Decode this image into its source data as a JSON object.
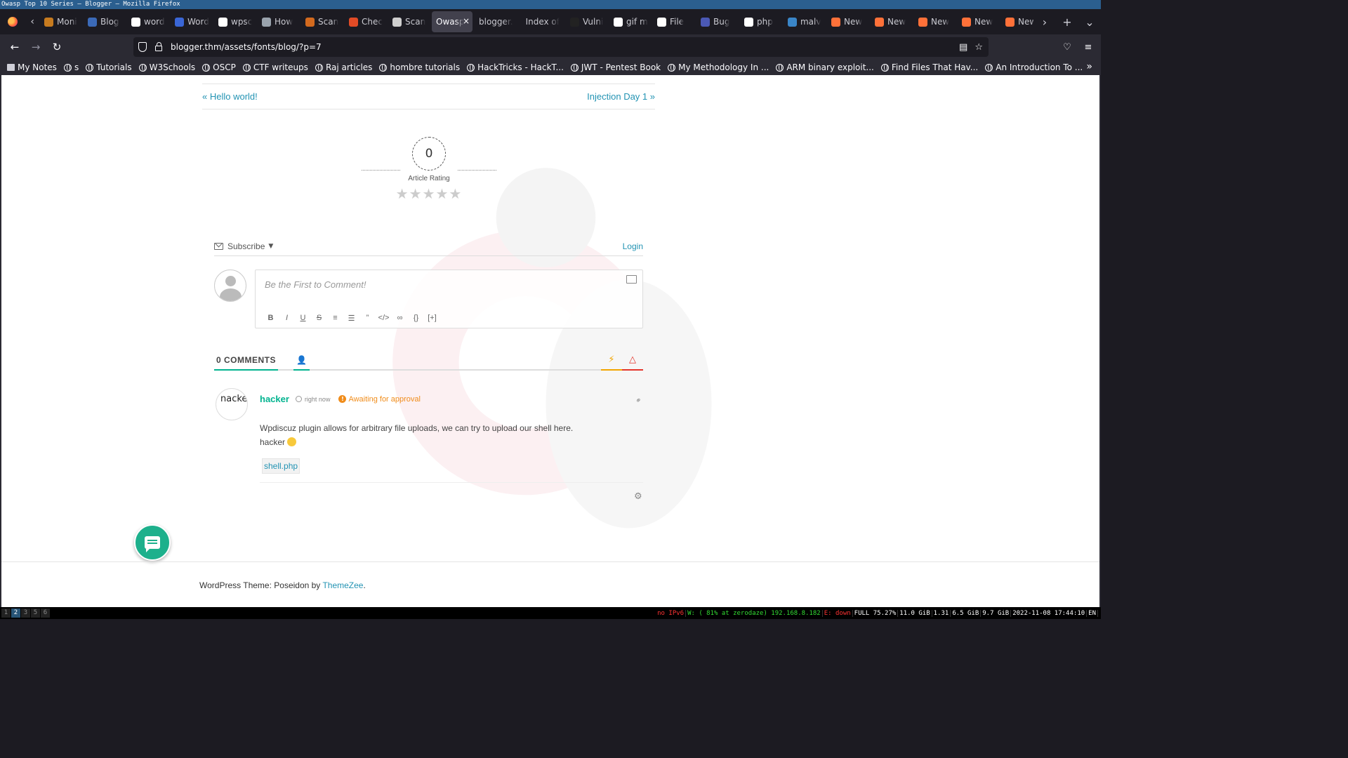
{
  "window": {
    "title": "Owasp Top 10 Series — Blogger — Mozilla Firefox"
  },
  "tabs": [
    {
      "label": "Moni",
      "color": "#c77b1f"
    },
    {
      "label": "Blog",
      "color": "#3b6ab8"
    },
    {
      "label": "word",
      "color": "#ffffff"
    },
    {
      "label": "Word",
      "color": "#3a66d6"
    },
    {
      "label": "wpsc",
      "color": "#ffffff"
    },
    {
      "label": "How",
      "color": "#9aa3ad"
    },
    {
      "label": "Scan",
      "color": "#d36a1e"
    },
    {
      "label": "Chec",
      "color": "#e24b26"
    },
    {
      "label": "Scan",
      "color": "#cfcfcf"
    },
    {
      "label": "Owasp",
      "active": true
    },
    {
      "label": "blogger."
    },
    {
      "label": "Index of"
    },
    {
      "label": "Vulni",
      "color": "#222222"
    },
    {
      "label": "gif m",
      "color": "#ffffff"
    },
    {
      "label": "File",
      "color": "#ffffff"
    },
    {
      "label": "Bug",
      "color": "#4b59b5"
    },
    {
      "label": "php",
      "color": "#ffffff"
    },
    {
      "label": "malv",
      "color": "#3a86c8"
    },
    {
      "label": "New",
      "color": "#ff7139"
    },
    {
      "label": "New",
      "color": "#ff7139"
    },
    {
      "label": "New",
      "color": "#ff7139"
    },
    {
      "label": "New",
      "color": "#ff7139"
    },
    {
      "label": "New",
      "color": "#ff7139"
    }
  ],
  "nav": {
    "url": "blogger.thm/assets/fonts/blog/?p=7"
  },
  "bookmarks": [
    "My Notes",
    "s",
    "Tutorials",
    "W3Schools",
    "OSCP",
    "CTF writeups",
    "Raj articles",
    "hombre tutorials",
    "HackTricks - HackT...",
    "JWT - Pentest Book",
    "My Methodology In ...",
    "ARM binary exploit...",
    "Find Files That Hav...",
    "An Introduction To ..."
  ],
  "page": {
    "prev_post": "« Hello world!",
    "next_post": "Injection Day 1 »",
    "rating_value": "0",
    "rating_label": "Article Rating",
    "stars": "★★★★★",
    "subscribe": "Subscribe",
    "login": "Login",
    "comment_placeholder": "Be the First to Comment!",
    "toolbar": [
      "B",
      "I",
      "U",
      "S",
      "≡",
      "☰",
      "”",
      "</>",
      "∞",
      "{}",
      "[+]"
    ],
    "comments_count": "0 COMMENTS",
    "comment": {
      "avatar_text": "nacke",
      "author": "hacker",
      "time": "right now",
      "status": "Awaiting for approval",
      "body_line1": "Wpdiscuz plugin allows for arbitrary file uploads, we can try to upload our shell here.",
      "body_line2": "hacker",
      "attachment": "shell.php"
    },
    "footer_text": "WordPress Theme: Poseidon by ",
    "footer_link": "ThemeZee",
    "footer_end": "."
  },
  "statusbar": {
    "workspaces": [
      "1",
      "2",
      "3",
      "5",
      "6"
    ],
    "active_workspace": "2",
    "ipv6": "no IPv6",
    "wifi": "W: ( 81% at zerodaze) 192.168.8.182",
    "eth": "E: down",
    "disk": "FULL 75.27%",
    "mem": "11.0 GiB",
    "load": "1.31",
    "mem2": "6.5 GiB",
    "mem3": "9.7 GiB",
    "datetime": "2022-11-08 17:44:10",
    "lang": "EN"
  }
}
